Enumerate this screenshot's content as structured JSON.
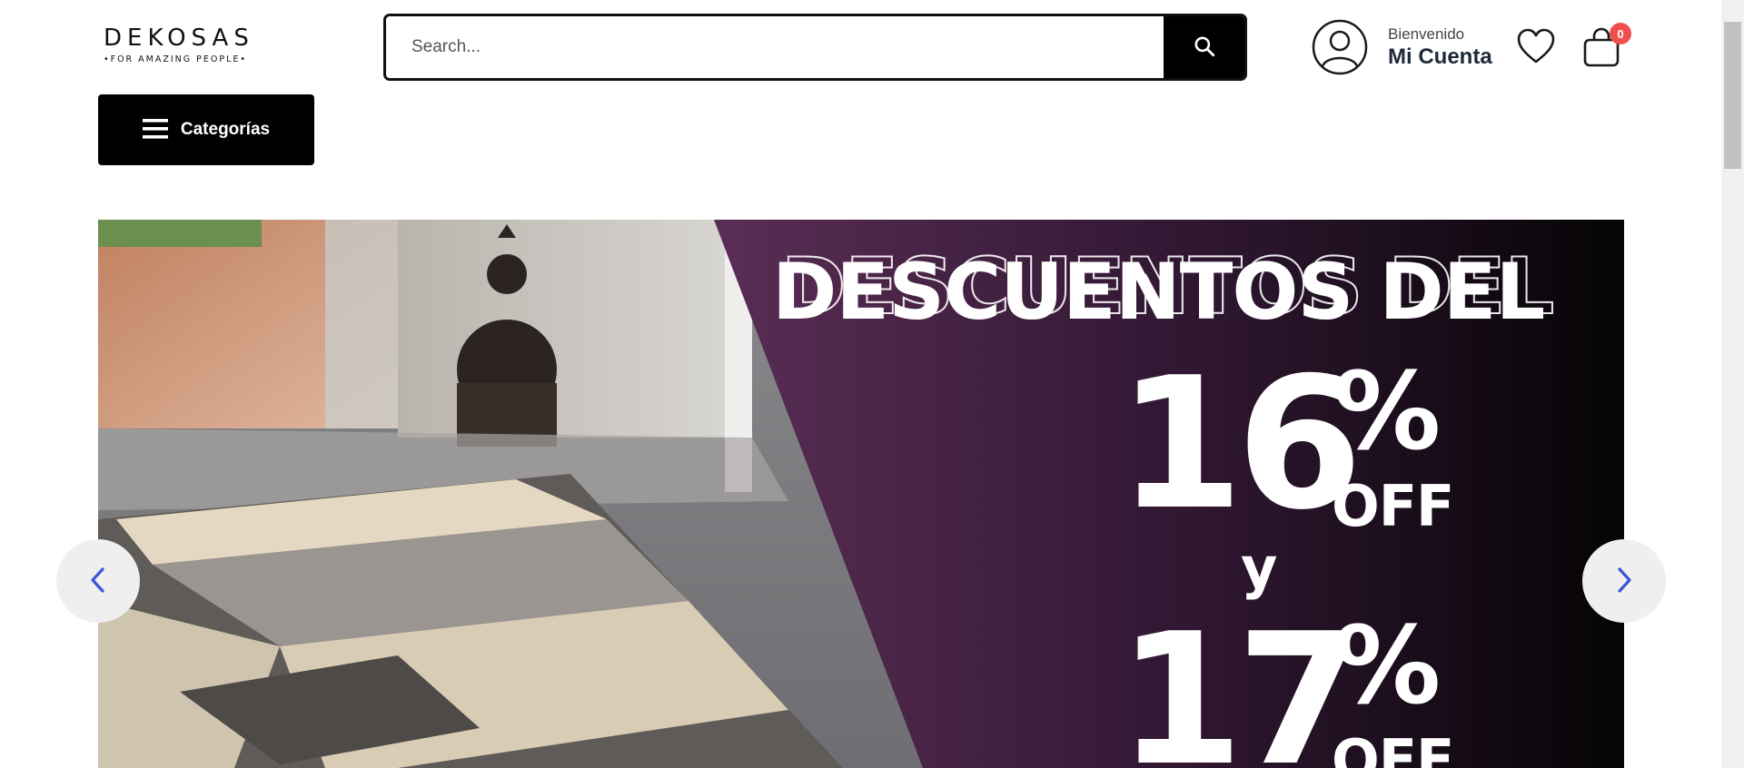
{
  "header": {
    "logo": {
      "name": "DEKOSAS",
      "tagline": "•FOR AMAZING PEOPLE•"
    },
    "search": {
      "placeholder": "Search...",
      "value": ""
    },
    "account": {
      "greeting": "Bienvenido",
      "title": "Mi Cuenta"
    },
    "cart": {
      "count": "0"
    },
    "icons": {
      "search": "search-icon",
      "account": "user-circle-icon",
      "wishlist": "heart-icon",
      "cart": "shopping-bag-icon",
      "menu": "hamburger-menu-icon"
    }
  },
  "categories": {
    "label": "Categorías"
  },
  "slider": {
    "headline": "DESCUENTOS DEL",
    "discount_one": "16",
    "discount_two": "17",
    "percent_symbol": "%",
    "off_label": "OFF",
    "connector": "y",
    "prev_icon": "chevron-left-icon",
    "next_icon": "chevron-right-icon"
  },
  "colors": {
    "accent": "#000000",
    "badge": "#ef4f4f",
    "promo_purple": "#5a2d55",
    "nav_arrow": "#3c54d8"
  }
}
